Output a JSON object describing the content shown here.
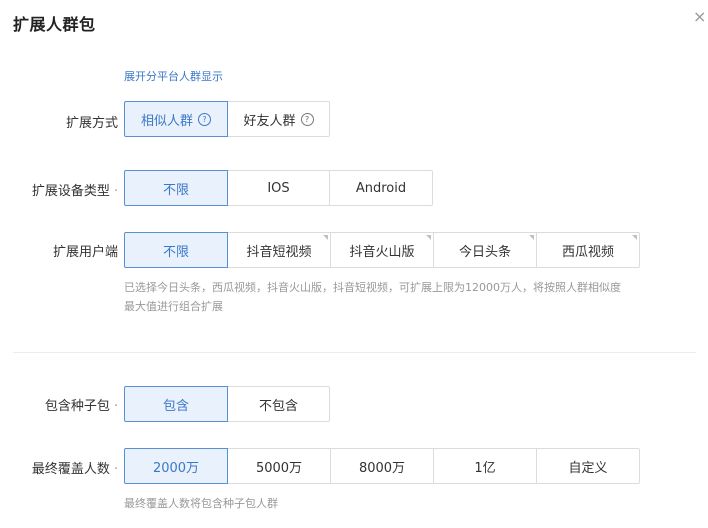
{
  "dialog": {
    "title": "扩展人群包",
    "close_glyph": "×"
  },
  "platform_link": "展开分平台人群显示",
  "expand_method": {
    "label": "扩展方式",
    "options": [
      "相似人群",
      "好友人群"
    ],
    "selected": 0
  },
  "device_type": {
    "label": "扩展设备类型",
    "dot": "·",
    "options": [
      "不限",
      "IOS",
      "Android"
    ],
    "selected": 0
  },
  "user_client": {
    "label": "扩展用户端",
    "options": [
      "不限",
      "抖音短视频",
      "抖音火山版",
      "今日头条",
      "西瓜视频"
    ],
    "selected": 0,
    "hint_line1": "已选择今日头条，西瓜视频，抖音火山版，抖音短视频，可扩展上限为12000万人，将按照人群相似度",
    "hint_line2": "最大值进行组合扩展"
  },
  "seed_pack": {
    "label": "包含种子包",
    "dot": "·",
    "options": [
      "包含",
      "不包含"
    ],
    "selected": 0
  },
  "final_coverage": {
    "label": "最终覆盖人数",
    "dot": "·",
    "options": [
      "2000万",
      "5000万",
      "8000万",
      "1亿",
      "自定义"
    ],
    "selected": 0,
    "hint": "最终覆盖人数将包含种子包人群"
  },
  "colors": {
    "accent": "#3b78c9",
    "selected_bg": "#e8f1fc",
    "border": "#dcdcdc"
  },
  "icons": {
    "help": "question-circle-icon",
    "close": "close-icon"
  }
}
